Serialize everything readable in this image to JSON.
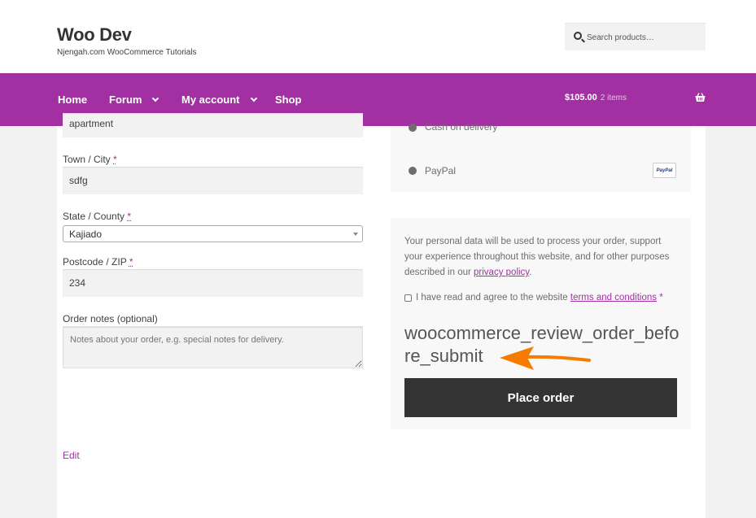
{
  "site": {
    "title": "Woo Dev",
    "description": "Njengah.com WooCommerce Tutorials"
  },
  "search": {
    "placeholder": "Search products…"
  },
  "nav": {
    "items": [
      {
        "label": "Home",
        "has_dropdown": false
      },
      {
        "label": "Forum",
        "has_dropdown": true
      },
      {
        "label": "My account",
        "has_dropdown": true
      },
      {
        "label": "Shop",
        "has_dropdown": false
      }
    ],
    "cart_total": "$105.00",
    "cart_count": "2 items"
  },
  "billing": {
    "apartment_value": "apartment",
    "town_label": "Town / City",
    "town_value": "sdfg",
    "state_label": "State / County",
    "state_value": "Kajiado",
    "postcode_label": "Postcode / ZIP",
    "postcode_value": "234",
    "notes_label": "Order notes (optional)",
    "notes_placeholder": "Notes about your order, e.g. special notes for delivery.",
    "required_mark": "*",
    "edit_label": "Edit"
  },
  "payment": {
    "methods": [
      {
        "label": "Cash on delivery"
      },
      {
        "label": "PayPal"
      }
    ],
    "paypal_logo_text": "PayPal"
  },
  "review": {
    "privacy_text": "Your personal data will be used to process your order, support your experience throughout this website, and for other purposes described in our ",
    "privacy_link": "privacy policy",
    "privacy_end": ".",
    "terms_text": "I have read and agree to the website ",
    "terms_link": "terms and conditions",
    "terms_required": "*",
    "hook_text": "woocommerce_review_order_before_submit",
    "place_order_label": "Place order"
  },
  "colors": {
    "accent": "#a230a3",
    "button": "#333333",
    "arrow": "#f57c00"
  },
  "icons": {
    "search": "search-icon",
    "cart": "basket-icon",
    "dropdown": "chevron-down-icon",
    "annotation": "arrow-left-icon"
  }
}
